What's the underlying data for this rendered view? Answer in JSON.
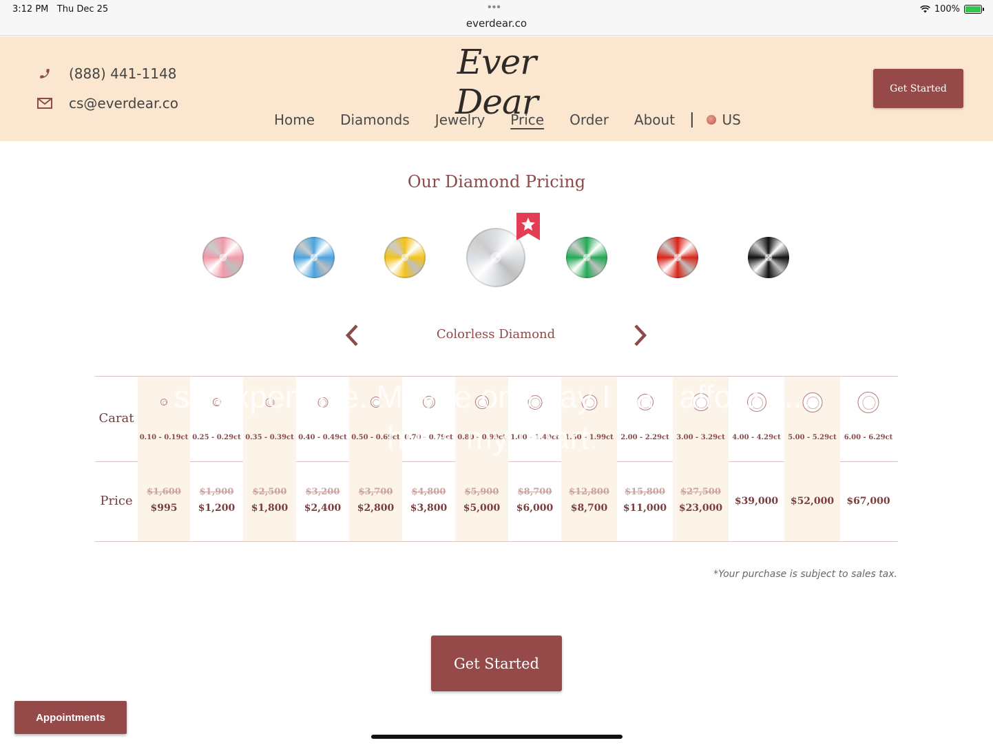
{
  "status_bar": {
    "time": "3:12 PM",
    "date": "Thu Dec 25",
    "url": "everdear.co",
    "battery": "100%"
  },
  "header": {
    "phone": "(888) 441-1148",
    "email": "cs@everdear.co",
    "logo": "Ever Dear",
    "nav": [
      "Home",
      "Diamonds",
      "Jewelry",
      "Price",
      "Order",
      "About"
    ],
    "active_nav": "Price",
    "region": "US",
    "cta": "Get Started"
  },
  "page": {
    "title": "Our Diamond Pricing",
    "selected_diamond": "Colorless Diamond",
    "diamond_colors": [
      {
        "name": "pink",
        "color": "#f09aa8"
      },
      {
        "name": "blue",
        "color": "#4aa3e0"
      },
      {
        "name": "yellow",
        "color": "#f2c21b"
      },
      {
        "name": "colorless",
        "color": "#dcdfe4"
      },
      {
        "name": "green",
        "color": "#23a955"
      },
      {
        "name": "red",
        "color": "#d8261a"
      },
      {
        "name": "black",
        "color": "#111111"
      }
    ],
    "overlay_text": "so expensive. Maybe one day I can afford it... hurts my heart."
  },
  "table": {
    "carat_label": "Carat",
    "price_label": "Price",
    "columns": [
      {
        "carat": "0.10 - 0.19ct",
        "old": "$1,600",
        "new": "$995"
      },
      {
        "carat": "0.25 - 0.29ct",
        "old": "$1,900",
        "new": "$1,200"
      },
      {
        "carat": "0.35 - 0.39ct",
        "old": "$2,500",
        "new": "$1,800"
      },
      {
        "carat": "0.40 - 0.49ct",
        "old": "$3,200",
        "new": "$2,400"
      },
      {
        "carat": "0.50 - 0.69ct",
        "old": "$3,700",
        "new": "$2,800"
      },
      {
        "carat": "0.70 - 0.79ct",
        "old": "$4,800",
        "new": "$3,800"
      },
      {
        "carat": "0.80 - 0.99ct",
        "old": "$5,900",
        "new": "$5,000"
      },
      {
        "carat": "1.00 - 1.49ct",
        "old": "$8,700",
        "new": "$6,000"
      },
      {
        "carat": "1.50 - 1.99ct",
        "old": "$12,800",
        "new": "$8,700"
      },
      {
        "carat": "2.00 - 2.29ct",
        "old": "$15,800",
        "new": "$11,000"
      },
      {
        "carat": "3.00 - 3.29ct",
        "old": "$27,500",
        "new": "$23,000"
      },
      {
        "carat": "4.00 - 4.29ct",
        "old": "",
        "new": "$39,000"
      },
      {
        "carat": "5.00 - 5.29ct",
        "old": "",
        "new": "$52,000"
      },
      {
        "carat": "6.00 - 6.29ct",
        "old": "",
        "new": "$67,000"
      }
    ]
  },
  "footer": {
    "tax_note": "*Your purchase is subject to sales tax.",
    "cta": "Get Started",
    "appointments": "Appointments"
  },
  "colors": {
    "brand": "#954a49",
    "header_bg": "#fbe6cf",
    "column_shade": "#fcf3e9"
  }
}
